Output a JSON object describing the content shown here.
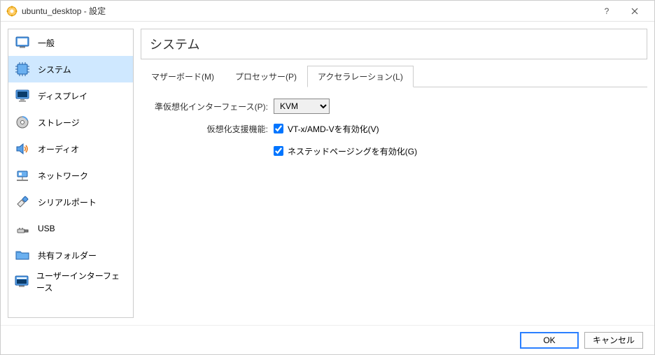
{
  "window": {
    "title": "ubuntu_desktop - 設定"
  },
  "sidebar": {
    "items": [
      {
        "label": "一般"
      },
      {
        "label": "システム"
      },
      {
        "label": "ディスプレイ"
      },
      {
        "label": "ストレージ"
      },
      {
        "label": "オーディオ"
      },
      {
        "label": "ネットワーク"
      },
      {
        "label": "シリアルポート"
      },
      {
        "label": "USB"
      },
      {
        "label": "共有フォルダー"
      },
      {
        "label": "ユーザーインターフェース"
      }
    ],
    "selected_index": 1
  },
  "panel": {
    "title": "システム",
    "tabs": [
      {
        "label": "マザーボード(M)"
      },
      {
        "label": "プロセッサー(P)"
      },
      {
        "label": "アクセラレーション(L)"
      }
    ],
    "active_tab": 2,
    "acceleration": {
      "paravirt_label": "準仮想化インターフェース(P):",
      "paravirt_value": "KVM",
      "hwvirt_label": "仮想化支援機能:",
      "vtx_label": "VT-x/AMD-Vを有効化(V)",
      "vtx_checked": true,
      "nested_label": "ネステッドページングを有効化(G)",
      "nested_checked": true
    }
  },
  "footer": {
    "ok": "OK",
    "cancel": "キャンセル"
  }
}
